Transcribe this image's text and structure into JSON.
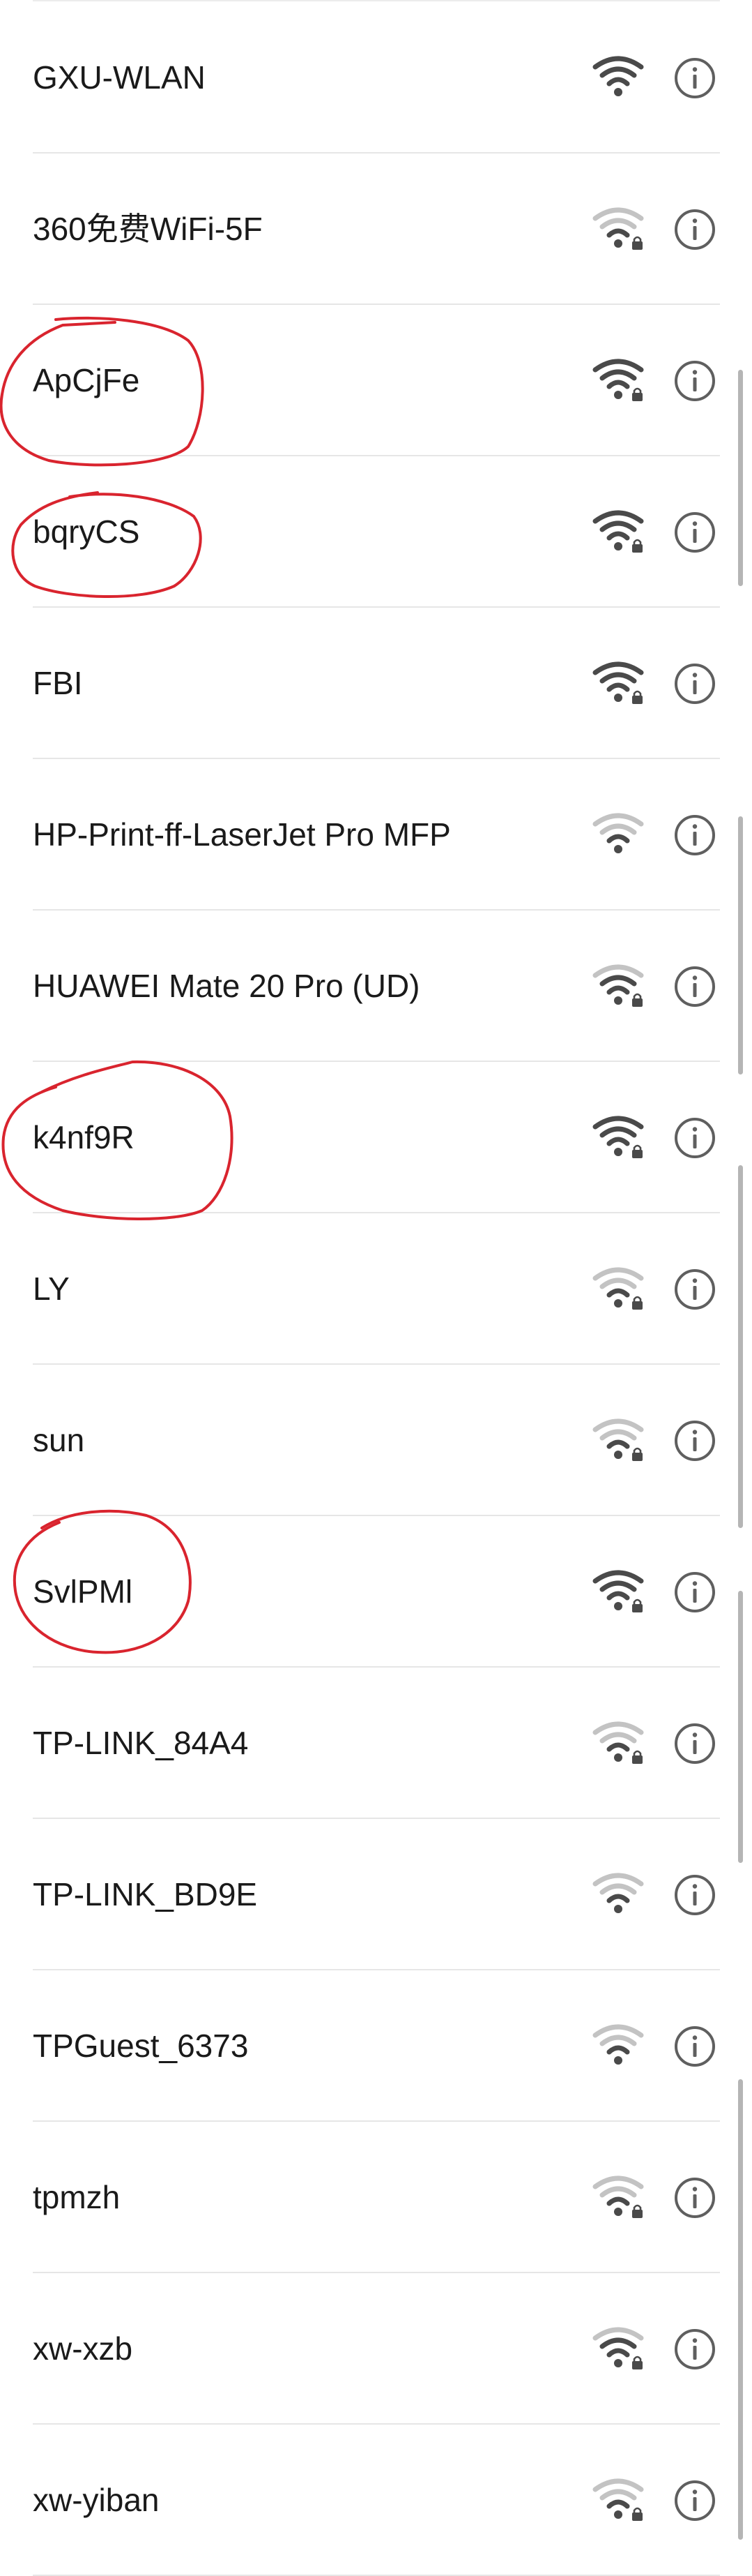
{
  "networks": [
    {
      "ssid": "GXU-WLAN",
      "signal_strength": "strong",
      "secured": false
    },
    {
      "ssid": "360免费WiFi-5F",
      "signal_strength": "weak",
      "secured": true
    },
    {
      "ssid": "ApCjFe",
      "signal_strength": "strong",
      "secured": true
    },
    {
      "ssid": "bqryCS",
      "signal_strength": "strong",
      "secured": true
    },
    {
      "ssid": "FBI",
      "signal_strength": "strong",
      "secured": true
    },
    {
      "ssid": "HP-Print-ff-LaserJet Pro MFP",
      "signal_strength": "weak",
      "secured": false
    },
    {
      "ssid": "HUAWEI Mate 20 Pro (UD)",
      "signal_strength": "medium",
      "secured": true
    },
    {
      "ssid": "k4nf9R",
      "signal_strength": "strong",
      "secured": true
    },
    {
      "ssid": "LY",
      "signal_strength": "weak",
      "secured": true
    },
    {
      "ssid": "sun",
      "signal_strength": "weak",
      "secured": true
    },
    {
      "ssid": "SvlPMl",
      "signal_strength": "strong",
      "secured": true
    },
    {
      "ssid": "TP-LINK_84A4",
      "signal_strength": "weak",
      "secured": true
    },
    {
      "ssid": "TP-LINK_BD9E",
      "signal_strength": "weak",
      "secured": false
    },
    {
      "ssid": "TPGuest_6373",
      "signal_strength": "weak",
      "secured": false
    },
    {
      "ssid": "tpmzh",
      "signal_strength": "weak",
      "secured": true
    },
    {
      "ssid": "xw-xzb",
      "signal_strength": "medium",
      "secured": true
    },
    {
      "ssid": "xw-yiban",
      "signal_strength": "weak",
      "secured": true
    }
  ],
  "annotated_networks": [
    "ApCjFe",
    "bqryCS",
    "k4nf9R",
    "SvlPMl"
  ],
  "icons": {
    "signal": "wifi-signal-icon",
    "lock": "lock-icon",
    "info": "info-icon"
  },
  "colors": {
    "icon_active": "#4a4a4a",
    "icon_inactive": "#c3c3c3",
    "annotation": "#d9242e"
  }
}
